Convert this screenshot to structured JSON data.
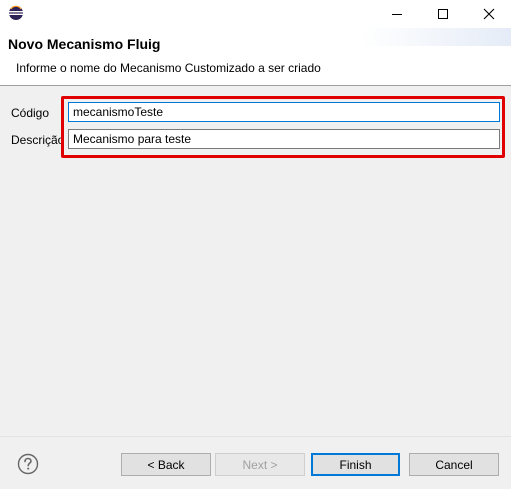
{
  "window": {
    "title_icon": "eclipse-icon",
    "controls": [
      "minimize-icon",
      "maximize-icon",
      "close-icon"
    ]
  },
  "banner": {
    "title": "Novo Mecanismo Fluig",
    "message": "Informe o nome do Mecanismo Customizado a ser criado"
  },
  "form": {
    "codigo_label": "Código",
    "codigo_value": "mecanismoTeste",
    "descricao_label": "Descrição",
    "descricao_value": "Mecanismo para teste"
  },
  "footer": {
    "help_icon": "help-icon",
    "back_label": "< Back",
    "next_label": "Next >",
    "finish_label": "Finish",
    "cancel_label": "Cancel"
  },
  "colors": {
    "highlight": "#e00000",
    "focus": "#0078d7"
  }
}
